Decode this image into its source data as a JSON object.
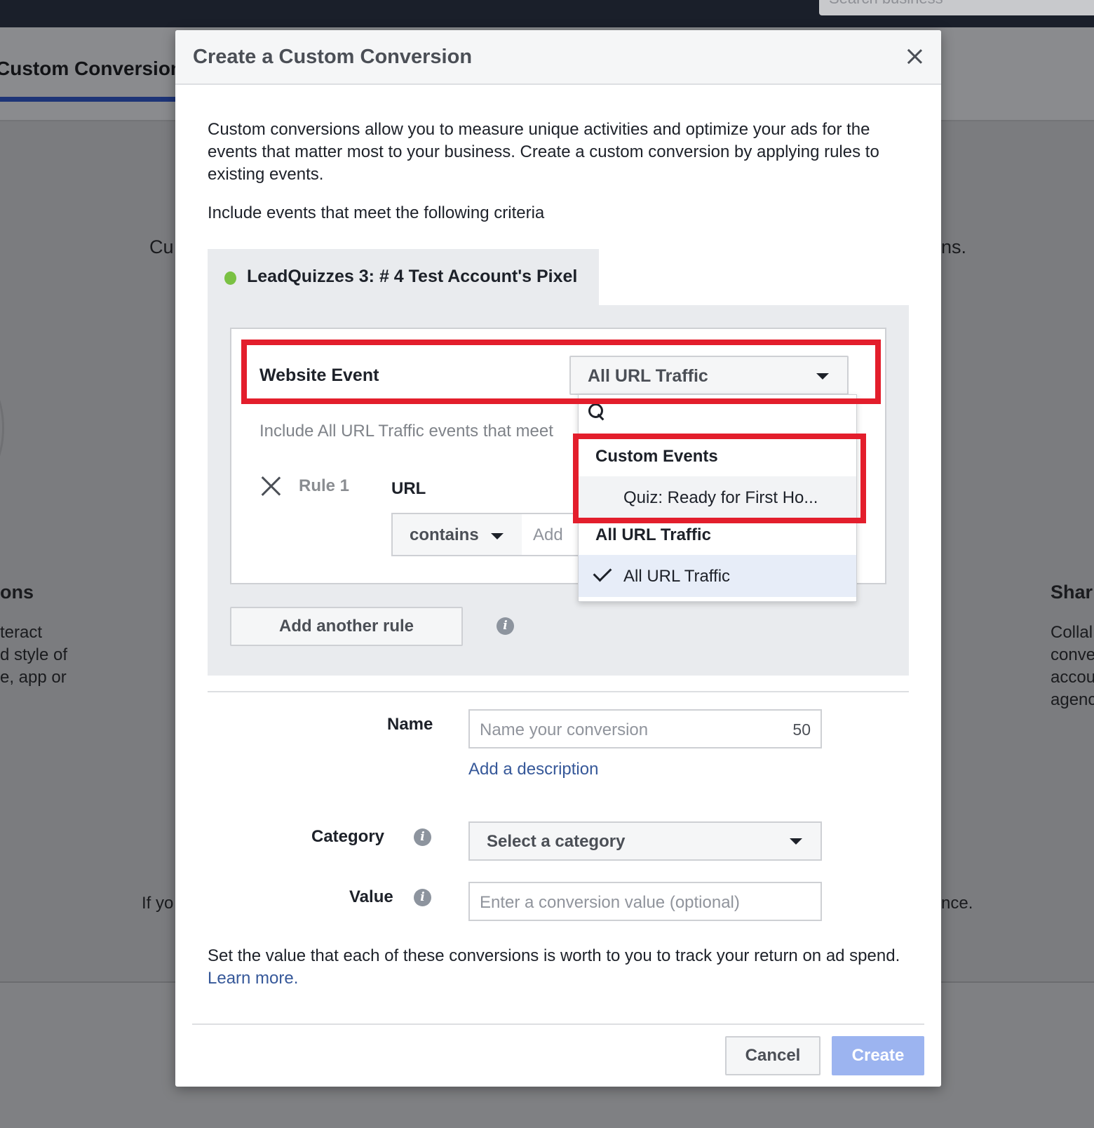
{
  "topbar": {
    "search_placeholder": "Search business"
  },
  "background": {
    "tab_title": "Custom Conversions",
    "center_heading_left": "Cu",
    "center_heading_right": "ns.",
    "left_section_title": "ons",
    "left_section_lines": [
      "teract",
      "d style of",
      "e, app or"
    ],
    "right_section_title": "Shar",
    "right_section_lines": [
      "Collal",
      "conve",
      "accou",
      "agenc"
    ],
    "bottom_left": "If yo",
    "bottom_right": "nce."
  },
  "modal": {
    "title": "Create a Custom Conversion",
    "intro": "Custom conversions allow you to measure unique activities and optimize your ads for the events that matter most to your business. Create a custom conversion by applying rules to existing events.",
    "criteria": "Include events that meet the following criteria",
    "pixel": {
      "name": "LeadQuizzes 3: # 4 Test Account's Pixel",
      "status_color": "#7ac143"
    },
    "website_event_label": "Website Event",
    "website_event_value": "All URL Traffic",
    "include_text": "Include All URL Traffic events that meet",
    "rule": {
      "label": "Rule 1",
      "field": "URL",
      "operator": "contains",
      "input_placeholder": "Add"
    },
    "add_rule_label": "Add another rule",
    "name_label": "Name",
    "name_placeholder": "Name your conversion",
    "name_counter": "50",
    "add_description": "Add a description",
    "category_label": "Category",
    "category_value": "Select a category",
    "value_label": "Value",
    "value_placeholder": "Enter a conversion value (optional)",
    "help_text": "Set the value that each of these conversions is worth to you to track your return on ad spend.",
    "learn_more": "Learn more.",
    "cancel_label": "Cancel",
    "create_label": "Create"
  },
  "dropdown": {
    "groups": [
      {
        "header": "Custom Events",
        "items": [
          {
            "label": "Quiz: Ready for First Ho...",
            "selected": false
          }
        ]
      },
      {
        "header": "All URL Traffic",
        "items": [
          {
            "label": "All URL Traffic",
            "selected": true
          }
        ]
      }
    ]
  },
  "colors": {
    "annotation": "#e31e2c",
    "link": "#365899",
    "primary_disabled": "#9cb4f0"
  }
}
